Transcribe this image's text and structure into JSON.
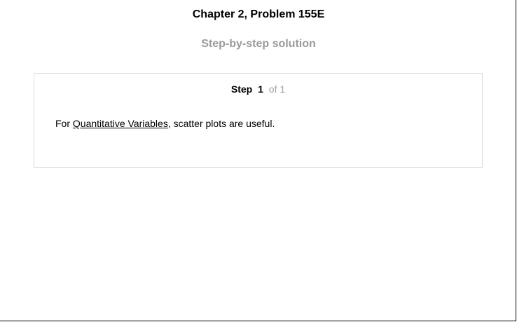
{
  "header": {
    "title": "Chapter 2, Problem 155E",
    "subtitle": "Step-by-step solution"
  },
  "step": {
    "label": "Step",
    "number": "1",
    "of_text": "of 1",
    "text_before": "For ",
    "link_text": "Quantitative Variables",
    "text_after": ", scatter plots are useful."
  },
  "colors": {
    "subtitle": "#9a9a9a",
    "card_border": "#dcdcdc",
    "step_of": "#a0a0a0"
  }
}
